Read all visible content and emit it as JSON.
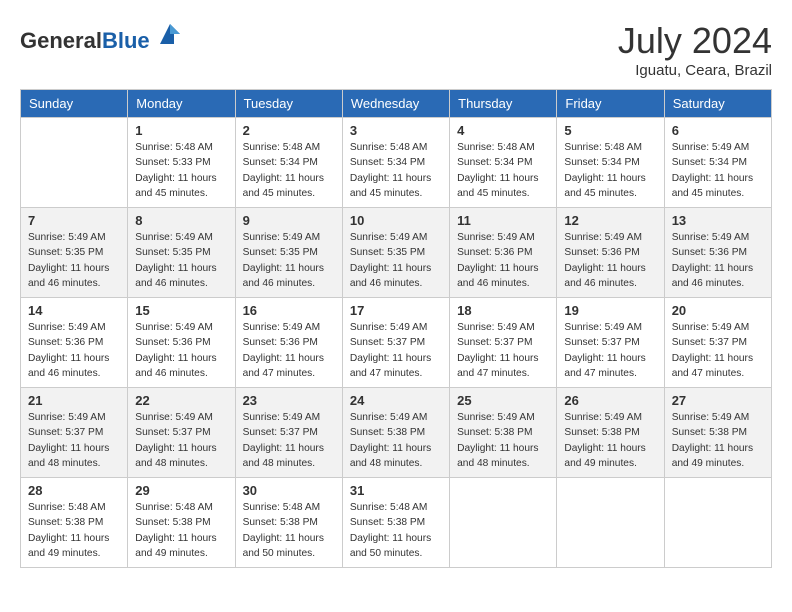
{
  "header": {
    "logo_general": "General",
    "logo_blue": "Blue",
    "month_year": "July 2024",
    "location": "Iguatu, Ceara, Brazil"
  },
  "days_of_week": [
    "Sunday",
    "Monday",
    "Tuesday",
    "Wednesday",
    "Thursday",
    "Friday",
    "Saturday"
  ],
  "weeks": [
    [
      {
        "day": "",
        "sunrise": "",
        "sunset": "",
        "daylight": ""
      },
      {
        "day": "1",
        "sunrise": "Sunrise: 5:48 AM",
        "sunset": "Sunset: 5:33 PM",
        "daylight": "Daylight: 11 hours and 45 minutes."
      },
      {
        "day": "2",
        "sunrise": "Sunrise: 5:48 AM",
        "sunset": "Sunset: 5:34 PM",
        "daylight": "Daylight: 11 hours and 45 minutes."
      },
      {
        "day": "3",
        "sunrise": "Sunrise: 5:48 AM",
        "sunset": "Sunset: 5:34 PM",
        "daylight": "Daylight: 11 hours and 45 minutes."
      },
      {
        "day": "4",
        "sunrise": "Sunrise: 5:48 AM",
        "sunset": "Sunset: 5:34 PM",
        "daylight": "Daylight: 11 hours and 45 minutes."
      },
      {
        "day": "5",
        "sunrise": "Sunrise: 5:48 AM",
        "sunset": "Sunset: 5:34 PM",
        "daylight": "Daylight: 11 hours and 45 minutes."
      },
      {
        "day": "6",
        "sunrise": "Sunrise: 5:49 AM",
        "sunset": "Sunset: 5:34 PM",
        "daylight": "Daylight: 11 hours and 45 minutes."
      }
    ],
    [
      {
        "day": "7",
        "sunrise": "Sunrise: 5:49 AM",
        "sunset": "Sunset: 5:35 PM",
        "daylight": "Daylight: 11 hours and 46 minutes."
      },
      {
        "day": "8",
        "sunrise": "Sunrise: 5:49 AM",
        "sunset": "Sunset: 5:35 PM",
        "daylight": "Daylight: 11 hours and 46 minutes."
      },
      {
        "day": "9",
        "sunrise": "Sunrise: 5:49 AM",
        "sunset": "Sunset: 5:35 PM",
        "daylight": "Daylight: 11 hours and 46 minutes."
      },
      {
        "day": "10",
        "sunrise": "Sunrise: 5:49 AM",
        "sunset": "Sunset: 5:35 PM",
        "daylight": "Daylight: 11 hours and 46 minutes."
      },
      {
        "day": "11",
        "sunrise": "Sunrise: 5:49 AM",
        "sunset": "Sunset: 5:36 PM",
        "daylight": "Daylight: 11 hours and 46 minutes."
      },
      {
        "day": "12",
        "sunrise": "Sunrise: 5:49 AM",
        "sunset": "Sunset: 5:36 PM",
        "daylight": "Daylight: 11 hours and 46 minutes."
      },
      {
        "day": "13",
        "sunrise": "Sunrise: 5:49 AM",
        "sunset": "Sunset: 5:36 PM",
        "daylight": "Daylight: 11 hours and 46 minutes."
      }
    ],
    [
      {
        "day": "14",
        "sunrise": "Sunrise: 5:49 AM",
        "sunset": "Sunset: 5:36 PM",
        "daylight": "Daylight: 11 hours and 46 minutes."
      },
      {
        "day": "15",
        "sunrise": "Sunrise: 5:49 AM",
        "sunset": "Sunset: 5:36 PM",
        "daylight": "Daylight: 11 hours and 46 minutes."
      },
      {
        "day": "16",
        "sunrise": "Sunrise: 5:49 AM",
        "sunset": "Sunset: 5:36 PM",
        "daylight": "Daylight: 11 hours and 47 minutes."
      },
      {
        "day": "17",
        "sunrise": "Sunrise: 5:49 AM",
        "sunset": "Sunset: 5:37 PM",
        "daylight": "Daylight: 11 hours and 47 minutes."
      },
      {
        "day": "18",
        "sunrise": "Sunrise: 5:49 AM",
        "sunset": "Sunset: 5:37 PM",
        "daylight": "Daylight: 11 hours and 47 minutes."
      },
      {
        "day": "19",
        "sunrise": "Sunrise: 5:49 AM",
        "sunset": "Sunset: 5:37 PM",
        "daylight": "Daylight: 11 hours and 47 minutes."
      },
      {
        "day": "20",
        "sunrise": "Sunrise: 5:49 AM",
        "sunset": "Sunset: 5:37 PM",
        "daylight": "Daylight: 11 hours and 47 minutes."
      }
    ],
    [
      {
        "day": "21",
        "sunrise": "Sunrise: 5:49 AM",
        "sunset": "Sunset: 5:37 PM",
        "daylight": "Daylight: 11 hours and 48 minutes."
      },
      {
        "day": "22",
        "sunrise": "Sunrise: 5:49 AM",
        "sunset": "Sunset: 5:37 PM",
        "daylight": "Daylight: 11 hours and 48 minutes."
      },
      {
        "day": "23",
        "sunrise": "Sunrise: 5:49 AM",
        "sunset": "Sunset: 5:37 PM",
        "daylight": "Daylight: 11 hours and 48 minutes."
      },
      {
        "day": "24",
        "sunrise": "Sunrise: 5:49 AM",
        "sunset": "Sunset: 5:38 PM",
        "daylight": "Daylight: 11 hours and 48 minutes."
      },
      {
        "day": "25",
        "sunrise": "Sunrise: 5:49 AM",
        "sunset": "Sunset: 5:38 PM",
        "daylight": "Daylight: 11 hours and 48 minutes."
      },
      {
        "day": "26",
        "sunrise": "Sunrise: 5:49 AM",
        "sunset": "Sunset: 5:38 PM",
        "daylight": "Daylight: 11 hours and 49 minutes."
      },
      {
        "day": "27",
        "sunrise": "Sunrise: 5:49 AM",
        "sunset": "Sunset: 5:38 PM",
        "daylight": "Daylight: 11 hours and 49 minutes."
      }
    ],
    [
      {
        "day": "28",
        "sunrise": "Sunrise: 5:48 AM",
        "sunset": "Sunset: 5:38 PM",
        "daylight": "Daylight: 11 hours and 49 minutes."
      },
      {
        "day": "29",
        "sunrise": "Sunrise: 5:48 AM",
        "sunset": "Sunset: 5:38 PM",
        "daylight": "Daylight: 11 hours and 49 minutes."
      },
      {
        "day": "30",
        "sunrise": "Sunrise: 5:48 AM",
        "sunset": "Sunset: 5:38 PM",
        "daylight": "Daylight: 11 hours and 50 minutes."
      },
      {
        "day": "31",
        "sunrise": "Sunrise: 5:48 AM",
        "sunset": "Sunset: 5:38 PM",
        "daylight": "Daylight: 11 hours and 50 minutes."
      },
      {
        "day": "",
        "sunrise": "",
        "sunset": "",
        "daylight": ""
      },
      {
        "day": "",
        "sunrise": "",
        "sunset": "",
        "daylight": ""
      },
      {
        "day": "",
        "sunrise": "",
        "sunset": "",
        "daylight": ""
      }
    ]
  ]
}
